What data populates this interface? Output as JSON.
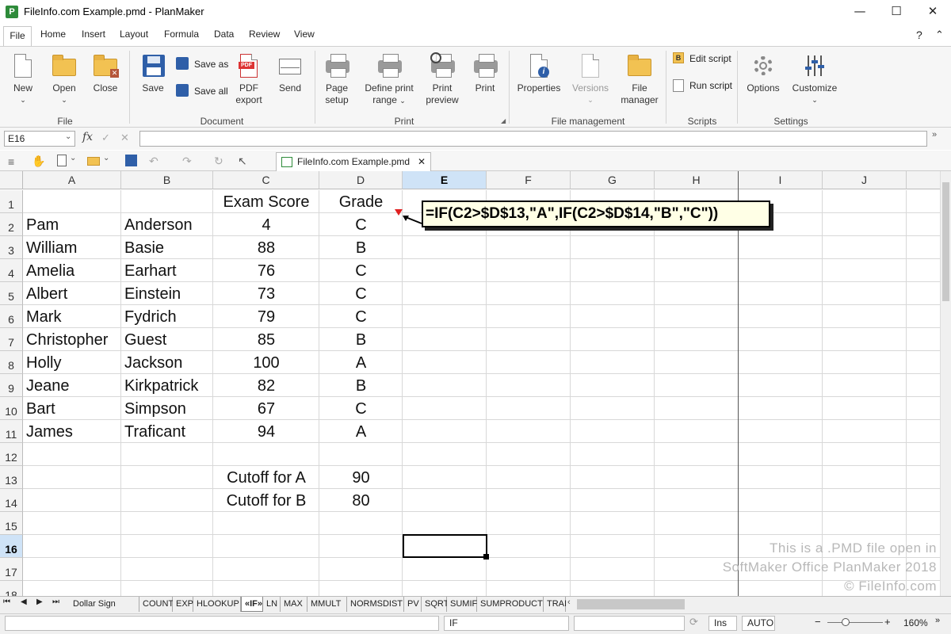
{
  "window": {
    "title": "FileInfo.com Example.pmd - PlanMaker",
    "app_icon_letter": "P",
    "min": "—",
    "max": "☐",
    "close": "✕"
  },
  "menu": {
    "items": [
      "File",
      "Home",
      "Insert",
      "Layout",
      "Formula",
      "Data",
      "Review",
      "View"
    ],
    "help": "?",
    "collapse": "⌃"
  },
  "ribbon": {
    "groups": {
      "file": "File",
      "document": "Document",
      "print": "Print",
      "file_management": "File management",
      "scripts": "Scripts",
      "settings": "Settings"
    },
    "buttons": {
      "new": "New",
      "open": "Open",
      "close": "Close",
      "save": "Save",
      "save_as": "Save as",
      "save_all": "Save all",
      "pdf_export_1": "PDF",
      "pdf_export_2": "export",
      "send": "Send",
      "page_setup_1": "Page",
      "page_setup_2": "setup",
      "define_print_1": "Define print",
      "define_print_2": "range",
      "print_preview_1": "Print",
      "print_preview_2": "preview",
      "print": "Print",
      "properties": "Properties",
      "versions": "Versions",
      "file_manager_1": "File",
      "file_manager_2": "manager",
      "edit_script": "Edit script",
      "run_script": "Run script",
      "options": "Options",
      "customize": "Customize"
    }
  },
  "formula_bar": {
    "cell_ref": "E16",
    "fx": "fx",
    "content": ""
  },
  "doc_tab": {
    "label": "FileInfo.com Example.pmd",
    "close": "✕"
  },
  "grid": {
    "columns": [
      "A",
      "B",
      "C",
      "D",
      "E",
      "F",
      "G",
      "H",
      "I",
      "J"
    ],
    "rows": [
      "1",
      "2",
      "3",
      "4",
      "5",
      "6",
      "7",
      "8",
      "9",
      "10",
      "11",
      "12",
      "13",
      "14",
      "15",
      "16",
      "17",
      "18"
    ],
    "header_c": "Exam Score",
    "header_d": "Grade",
    "students": [
      {
        "first": "Pam",
        "last": "Anderson",
        "score": "4",
        "grade": "C"
      },
      {
        "first": "William",
        "last": "Basie",
        "score": "88",
        "grade": "B"
      },
      {
        "first": "Amelia",
        "last": "Earhart",
        "score": "76",
        "grade": "C"
      },
      {
        "first": "Albert",
        "last": "Einstein",
        "score": "73",
        "grade": "C"
      },
      {
        "first": "Mark",
        "last": "Fydrich",
        "score": "79",
        "grade": "C"
      },
      {
        "first": "Christopher",
        "last": "Guest",
        "score": "85",
        "grade": "B"
      },
      {
        "first": "Holly",
        "last": "Jackson",
        "score": "100",
        "grade": "A"
      },
      {
        "first": "Jeane",
        "last": "Kirkpatrick",
        "score": "82",
        "grade": "B"
      },
      {
        "first": "Bart",
        "last": "Simpson",
        "score": "67",
        "grade": "C"
      },
      {
        "first": "James",
        "last": "Traficant",
        "score": "94",
        "grade": "A"
      }
    ],
    "cutoff_a_label": "Cutoff for A",
    "cutoff_a_value": "90",
    "cutoff_b_label": "Cutoff for B",
    "cutoff_b_value": "80",
    "selected_cell": "E16"
  },
  "callout": "=IF(C2>$D$13,\"A\",IF(C2>$D$14,\"B\",\"C\"))",
  "watermark": {
    "line1": "This is a .PMD file open in",
    "line2": "SoftMaker Office PlanMaker 2018",
    "line3": "© FileInfo.com"
  },
  "sheet_tabs": [
    "Dollar Sign",
    "COUNT",
    "EXP",
    "HLOOKUP",
    "«IF»",
    "LN",
    "MAX",
    "MMULT",
    "NORMSDIST",
    "PV",
    "SQRT",
    "SUMIF",
    "SUMPRODUCT",
    "TRAI"
  ],
  "active_sheet": "«IF»",
  "status": {
    "function": "IF",
    "ins": "Ins",
    "auto": "AUTO",
    "zoom": "160%",
    "minus": "−",
    "plus": "+"
  }
}
